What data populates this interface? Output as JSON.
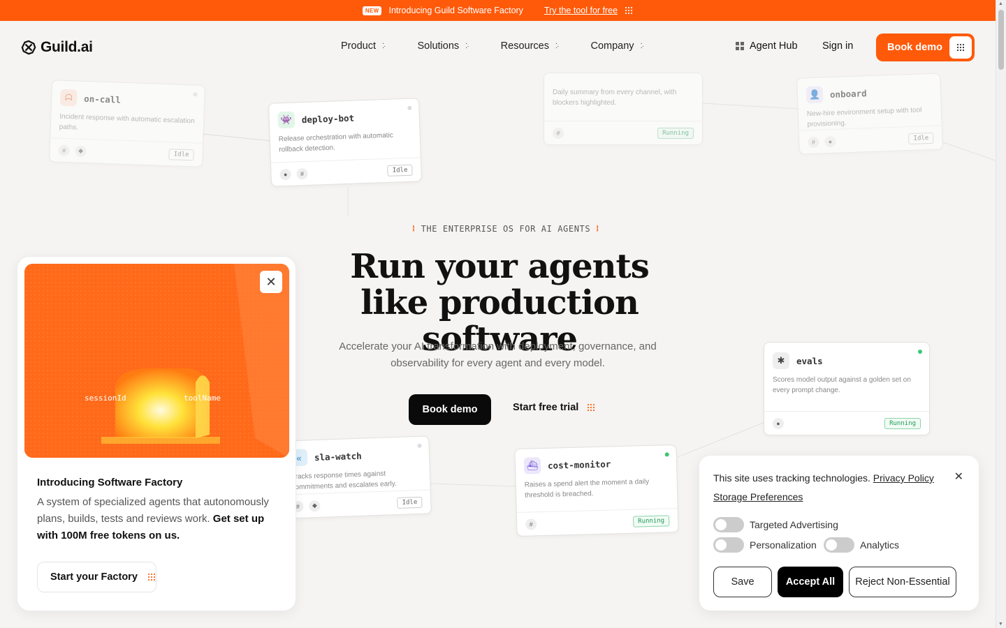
{
  "announcement": {
    "badge": "NEW",
    "text": "Introducing Guild Software Factory",
    "link": "Try the tool for free"
  },
  "nav": {
    "logo_text": "Guild.ai",
    "menu": [
      {
        "label": "Product"
      },
      {
        "label": "Solutions"
      },
      {
        "label": "Resources"
      },
      {
        "label": "Company"
      }
    ],
    "agent_hub": "Agent Hub",
    "sign_in": "Sign in",
    "book_demo": "Book demo"
  },
  "cards": {
    "oncall": {
      "name": "on-call",
      "desc": "Incident response with automatic escalation paths.",
      "status": "Idle"
    },
    "deploy": {
      "name": "deploy-bot",
      "desc": "Release orchestration with automatic rollback detection.",
      "status": "Idle"
    },
    "summary": {
      "desc": "Daily summary from every channel, with blockers highlighted.",
      "status": "Running"
    },
    "onboard": {
      "name": "onboard",
      "desc": "New-hire environment setup with tool provisioning.",
      "status": "Idle"
    },
    "evals": {
      "name": "evals",
      "desc": "Scores model output against a golden set on every prompt change.",
      "status": "Running"
    },
    "sla": {
      "name": "sla-watch",
      "desc": "Tracks response times against commitments and escalates early.",
      "status": "Idle"
    },
    "cost": {
      "name": "cost-monitor",
      "desc": "Raises a spend alert the moment a daily threshold is breached.",
      "status": "Running"
    }
  },
  "hero": {
    "eyebrow": "THE ENTERPRISE OS FOR AI AGENTS",
    "title_line1": "Run your agents",
    "title_line2": "like production software",
    "subtitle": "Accelerate your AI transformation with deployment, governance, and observability for every agent and every model.",
    "primary_cta": "Book demo",
    "secondary_cta": "Start free trial"
  },
  "promo": {
    "art_text_1": "sessionId",
    "art_text_2": "toolName",
    "title": "Introducing Software Factory",
    "body": "A system of specialized agents that autonomously plans, builds, tests and reviews work.",
    "body_bold": "Get set up with 100M free tokens on us.",
    "cta": "Start your Factory"
  },
  "cookie": {
    "text": "This site uses tracking technologies.",
    "privacy_link": "Privacy Policy",
    "storage_link": "Storage Preferences",
    "toggles": [
      {
        "label": "Targeted Advertising",
        "on": false
      },
      {
        "label": "Personalization",
        "on": false
      },
      {
        "label": "Analytics",
        "on": false
      }
    ],
    "save": "Save",
    "accept": "Accept All",
    "reject": "Reject Non-Essential"
  },
  "colors": {
    "brand": "#ff5a0a",
    "running": "#1f9a55"
  }
}
